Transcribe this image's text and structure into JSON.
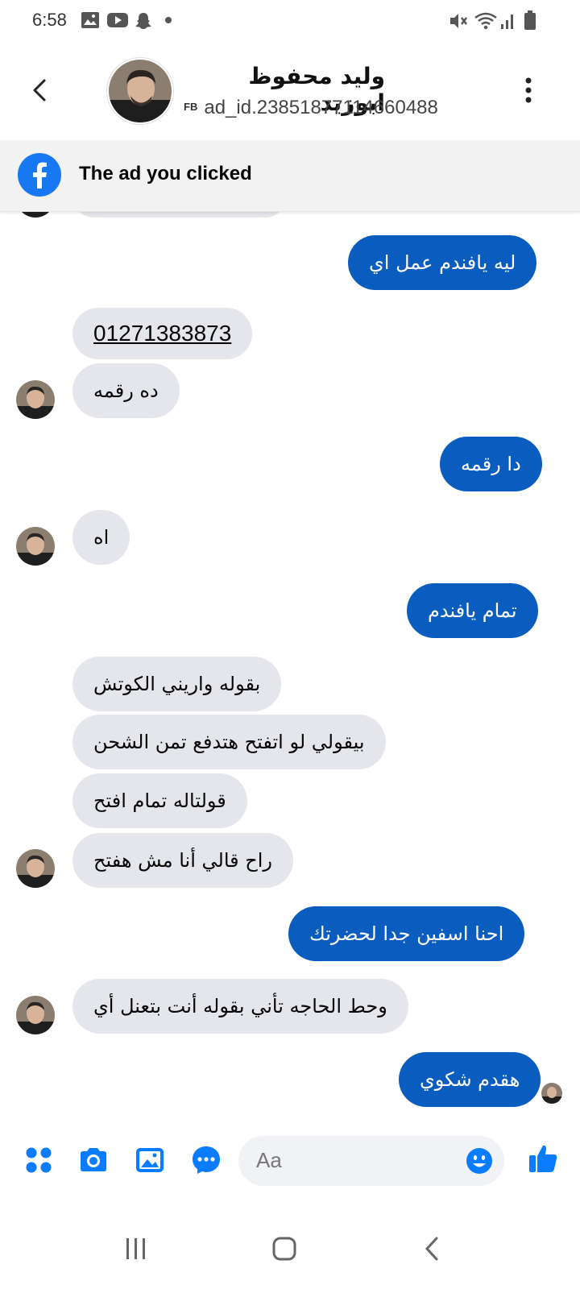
{
  "status_bar": {
    "time": "6:58",
    "icons": [
      "image-icon",
      "youtube-icon",
      "snapchat-icon",
      "dot-icon",
      "mute-icon",
      "wifi-icon",
      "signal-icon",
      "battery-icon"
    ]
  },
  "header": {
    "contact_name": "وليد محفوظ ابوزيد",
    "source_tag": "FB",
    "ad_id": "ad_id.23851877114660488"
  },
  "ad_banner": {
    "text": "The ad you clicked"
  },
  "messages": [
    {
      "from": "me",
      "text": "ليه يافندم عمل اي"
    },
    {
      "from": "contact",
      "text": "01271383873"
    },
    {
      "from": "contact",
      "text": "ده رقمه"
    },
    {
      "from": "me",
      "text": "دا رقمه"
    },
    {
      "from": "contact",
      "text": "اه"
    },
    {
      "from": "me",
      "text": "تمام يافندم"
    },
    {
      "from": "contact",
      "text": "بقوله واريني الكوتش"
    },
    {
      "from": "contact",
      "text": "بيقولي لو اتفتح هتدفع تمن الشحن"
    },
    {
      "from": "contact",
      "text": "قولتاله تمام افتح"
    },
    {
      "from": "contact",
      "text": "راح قالي أنا مش هفتح"
    },
    {
      "from": "me",
      "text": "احنا اسفين جدا لحضرتك"
    },
    {
      "from": "contact",
      "text": "وحط الحاجه تأني بقوله أنت بتعنل أي"
    },
    {
      "from": "me",
      "text": "هقدم شكوي"
    }
  ],
  "composer": {
    "placeholder": "Aa"
  },
  "colors": {
    "accent": "#0b5cbf",
    "messenger_blue": "#1877f2",
    "incoming_bubble": "#e4e6eb",
    "banner_bg": "#f2f2f2"
  }
}
